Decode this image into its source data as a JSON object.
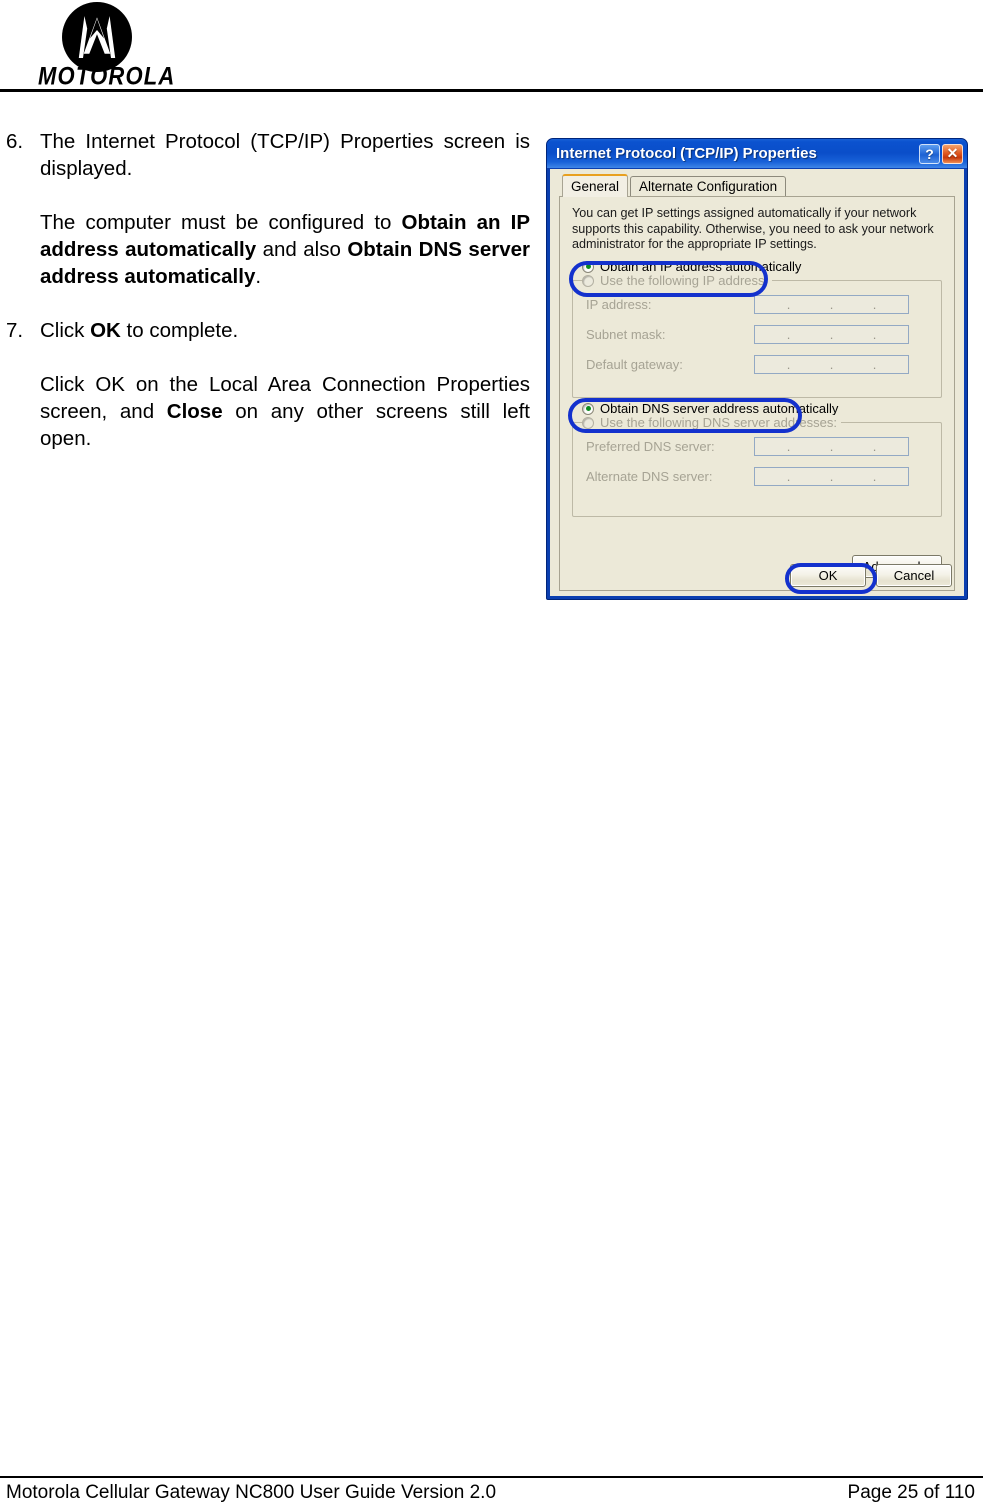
{
  "header": {
    "logo_name": "motorola-logo",
    "wordmark": "MOTOROLA"
  },
  "instructions": {
    "steps": [
      {
        "number": "6.",
        "paragraphs": [
          {
            "runs": [
              {
                "text": "The Internet Protocol (TCP/IP) Properties screen is displayed.",
                "bold": false
              }
            ]
          },
          {
            "runs": [
              {
                "text": "The computer must be configured to ",
                "bold": false
              },
              {
                "text": "Obtain an IP address automatically",
                "bold": true
              },
              {
                "text": " and also ",
                "bold": false
              },
              {
                "text": "Obtain DNS server address automatically",
                "bold": true
              },
              {
                "text": ".",
                "bold": false
              }
            ]
          }
        ]
      },
      {
        "number": "7.",
        "paragraphs": [
          {
            "runs": [
              {
                "text": "Click ",
                "bold": false
              },
              {
                "text": "OK",
                "bold": true
              },
              {
                "text": " to complete.",
                "bold": false
              }
            ]
          },
          {
            "runs": [
              {
                "text": "Click OK on the Local Area Connection Properties screen, and ",
                "bold": false
              },
              {
                "text": "Close",
                "bold": true
              },
              {
                "text": " on any other screens still left open.",
                "bold": false
              }
            ]
          }
        ]
      }
    ]
  },
  "dialog": {
    "title": "Internet Protocol (TCP/IP) Properties",
    "help_button": "?",
    "close_button": "✕",
    "tabs": [
      {
        "label": "General",
        "active": true
      },
      {
        "label": "Alternate Configuration",
        "active": false
      }
    ],
    "intro_text": "You can get IP settings assigned automatically if your network supports this capability. Otherwise, you need to ask your network administrator for the appropriate IP settings.",
    "ip_section": {
      "auto_radio_label": "Obtain an IP address automatically",
      "auto_radio_selected": true,
      "manual_radio_label": "Use the following IP address:",
      "manual_radio_selected": false,
      "fields": [
        {
          "label": "IP address:",
          "value": ""
        },
        {
          "label": "Subnet mask:",
          "value": ""
        },
        {
          "label": "Default gateway:",
          "value": ""
        }
      ]
    },
    "dns_section": {
      "auto_radio_label": "Obtain DNS server address automatically",
      "auto_radio_selected": true,
      "manual_radio_label": "Use the following DNS server addresses:",
      "manual_radio_selected": false,
      "fields": [
        {
          "label": "Preferred DNS server:",
          "value": ""
        },
        {
          "label": "Alternate DNS server:",
          "value": ""
        }
      ]
    },
    "advanced_button": "Advanced...",
    "ok_button": "OK",
    "cancel_button": "Cancel",
    "colors": {
      "titlebar_blue": "#0a4ec9",
      "dialog_face": "#ece9d8",
      "annotation_blue": "#1331cd",
      "radio_dot_green": "#0b8b1e",
      "active_tab_accent": "#e8a020"
    },
    "annotations": [
      {
        "name": "highlight-obtain-ip",
        "target": "obtain-ip-automatically-radio"
      },
      {
        "name": "highlight-obtain-dns",
        "target": "obtain-dns-automatically-radio"
      },
      {
        "name": "highlight-ok",
        "target": "ok-button"
      }
    ]
  },
  "footer": {
    "left": "Motorola Cellular Gateway NC800 User Guide Version 2.0",
    "right": "Page 25 of 110"
  }
}
